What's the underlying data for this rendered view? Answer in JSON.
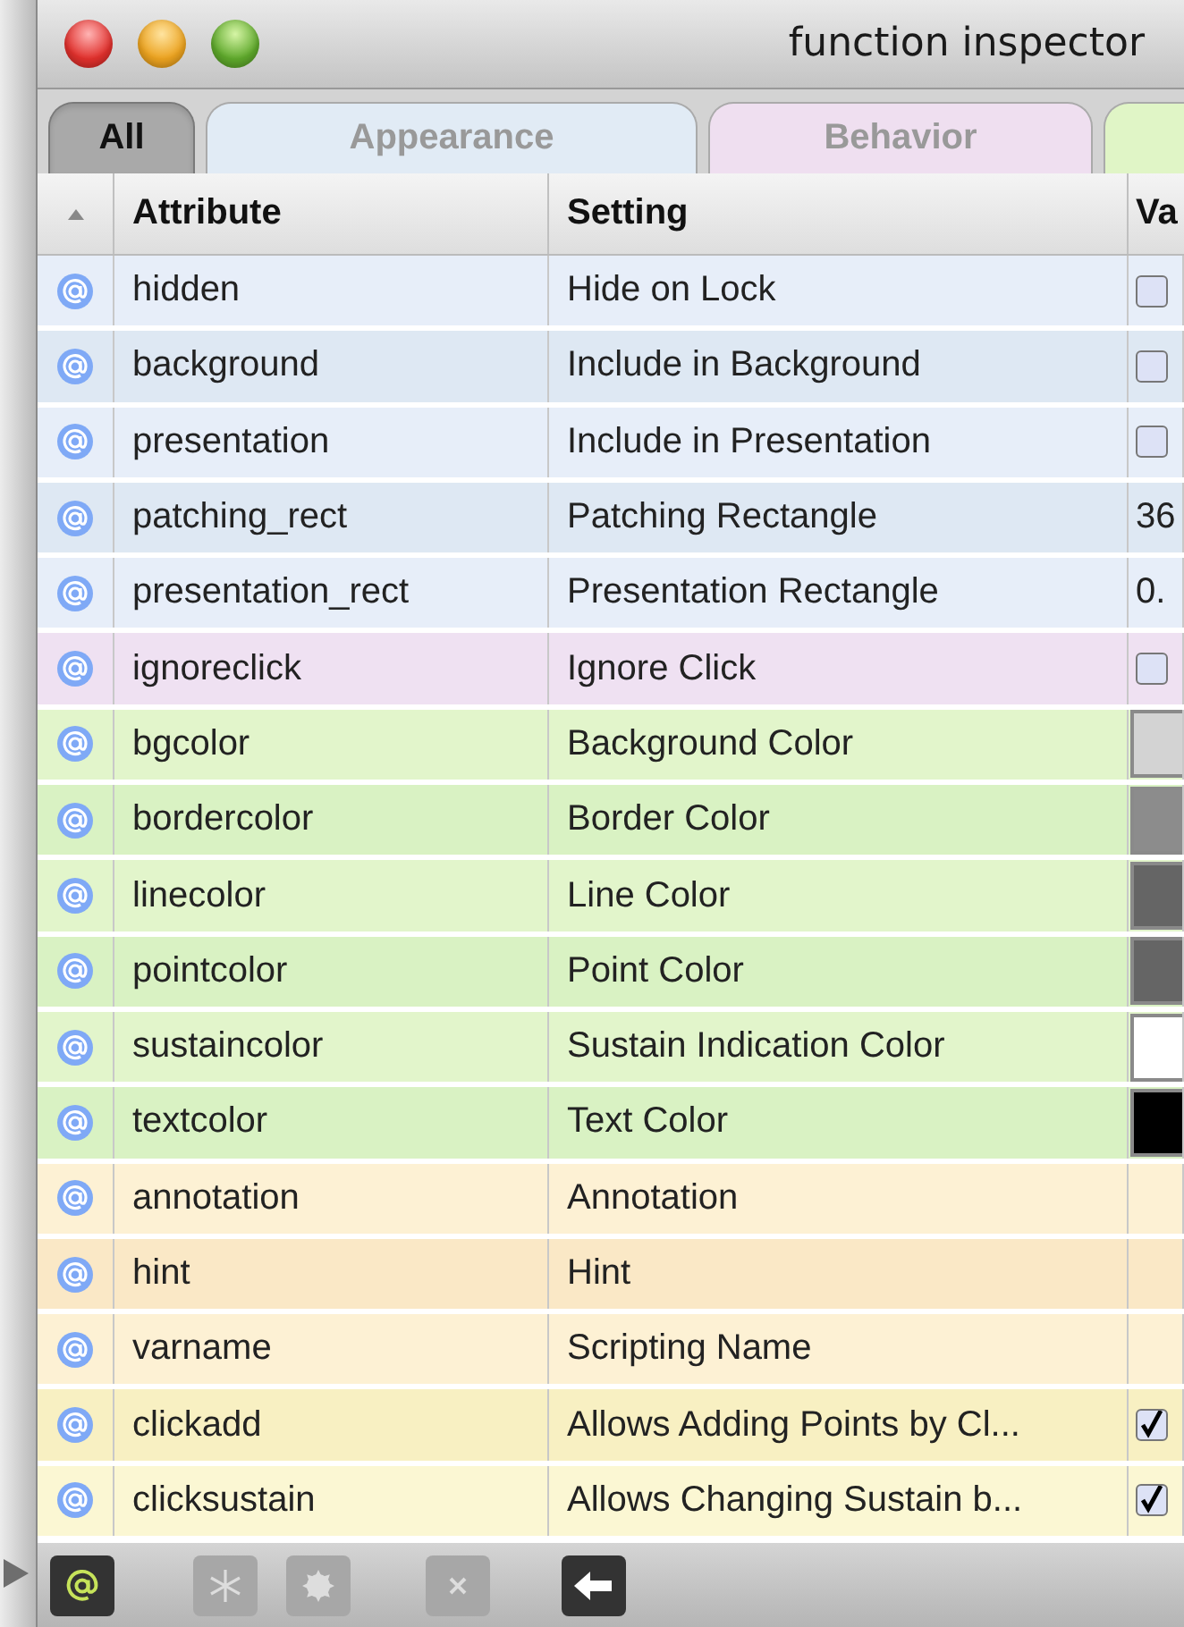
{
  "window": {
    "title": "function inspector"
  },
  "tabs": [
    {
      "label": "All",
      "selected": true,
      "color": "#a9a9a9"
    },
    {
      "label": "Appearance",
      "selected": false,
      "color": "#e1ebf5"
    },
    {
      "label": "Behavior",
      "selected": false,
      "color": "#efdff0"
    },
    {
      "selected": false,
      "color": "#e0f5c6"
    }
  ],
  "table": {
    "columns": [
      "Attribute",
      "Setting",
      "Va"
    ],
    "sort_ascending": true,
    "rows": [
      {
        "color": "#e7eef9",
        "attribute": "hidden",
        "setting": "Hide on Lock",
        "value": {
          "kind": "checkbox",
          "checked": false
        }
      },
      {
        "color": "#dee8f3",
        "attribute": "background",
        "setting": "Include in Background",
        "value": {
          "kind": "checkbox",
          "checked": false
        }
      },
      {
        "color": "#e7eef9",
        "attribute": "presentation",
        "setting": "Include in Presentation",
        "value": {
          "kind": "checkbox",
          "checked": false
        }
      },
      {
        "color": "#dee8f3",
        "attribute": "patching_rect",
        "setting": "Patching Rectangle",
        "value": {
          "kind": "text",
          "text": "36"
        }
      },
      {
        "color": "#e7eef9",
        "attribute": "presentation_rect",
        "setting": "Presentation Rectangle",
        "value": {
          "kind": "text",
          "text": "0."
        }
      },
      {
        "color": "#efe1f2",
        "attribute": "ignoreclick",
        "setting": "Ignore Click",
        "value": {
          "kind": "checkbox",
          "checked": false
        }
      },
      {
        "color": "#e2f5cb",
        "attribute": "bgcolor",
        "setting": "Background Color",
        "value": {
          "kind": "swatch",
          "color": "#d3d3d3"
        }
      },
      {
        "color": "#d9f2c3",
        "attribute": "bordercolor",
        "setting": "Border Color",
        "value": {
          "kind": "swatch",
          "color": "#8c8c8c"
        }
      },
      {
        "color": "#e2f5cb",
        "attribute": "linecolor",
        "setting": "Line Color",
        "value": {
          "kind": "swatch",
          "color": "#656565"
        }
      },
      {
        "color": "#d9f2c3",
        "attribute": "pointcolor",
        "setting": "Point Color",
        "value": {
          "kind": "swatch",
          "color": "#656565"
        }
      },
      {
        "color": "#e2f5cb",
        "attribute": "sustaincolor",
        "setting": "Sustain Indication Color",
        "value": {
          "kind": "swatch",
          "color": "#ffffff"
        }
      },
      {
        "color": "#d9f2c3",
        "attribute": "textcolor",
        "setting": "Text Color",
        "value": {
          "kind": "swatch",
          "color": "#000000"
        }
      },
      {
        "color": "#fdf1d4",
        "attribute": "annotation",
        "setting": "Annotation"
      },
      {
        "color": "#fae8c6",
        "attribute": "hint",
        "setting": "Hint"
      },
      {
        "color": "#fdf1d4",
        "attribute": "varname",
        "setting": "Scripting Name"
      },
      {
        "color": "#f8f0c2",
        "attribute": "clickadd",
        "setting": "Allows Adding Points by Cl...",
        "value": {
          "kind": "checkbox",
          "checked": true
        }
      },
      {
        "color": "#fbf7d3",
        "attribute": "clicksustain",
        "setting": "Allows Changing Sustain b...",
        "value": {
          "kind": "checkbox",
          "checked": true
        }
      }
    ]
  },
  "toolbar": [
    {
      "kind": "at",
      "disabled": false
    },
    {
      "kind": "snowflake",
      "disabled": true
    },
    {
      "kind": "gear",
      "disabled": true
    },
    {
      "kind": "close",
      "disabled": true
    },
    {
      "kind": "back",
      "disabled": false
    }
  ]
}
